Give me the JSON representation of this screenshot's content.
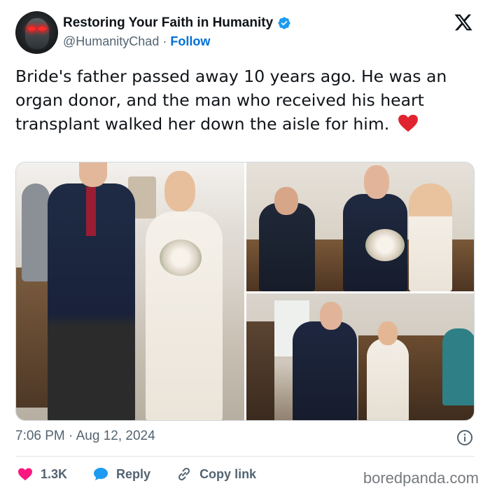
{
  "author": {
    "display_name": "Restoring Your Faith in Humanity",
    "handle": "@HumanityChad",
    "separator": "·",
    "follow_label": "Follow",
    "avatar_icon": "glowing-eyes-avatar",
    "verified_icon": "verified-badge-icon",
    "verified_color": "#1d9bf0"
  },
  "platform_icon": "x-logo-icon",
  "tweet": {
    "text": "Bride's father passed away 10 years ago. He was an organ donor, and the man who received his heart transplant walked her down the aisle for him.",
    "emoji": "red-heart-icon"
  },
  "media": {
    "photos": [
      {
        "name": "photo-walking-down-aisle"
      },
      {
        "name": "photo-greeting-groom"
      },
      {
        "name": "photo-church-aisle"
      }
    ]
  },
  "meta": {
    "time": "7:06 PM",
    "separator": "·",
    "date": "Aug 12, 2024",
    "info_icon": "info-icon"
  },
  "actions": {
    "like_count": "1.3K",
    "like_color": "#f91880",
    "reply_label": "Reply",
    "reply_color": "#1d9bf0",
    "copy_label": "Copy link"
  },
  "watermark": "boredpanda.com"
}
